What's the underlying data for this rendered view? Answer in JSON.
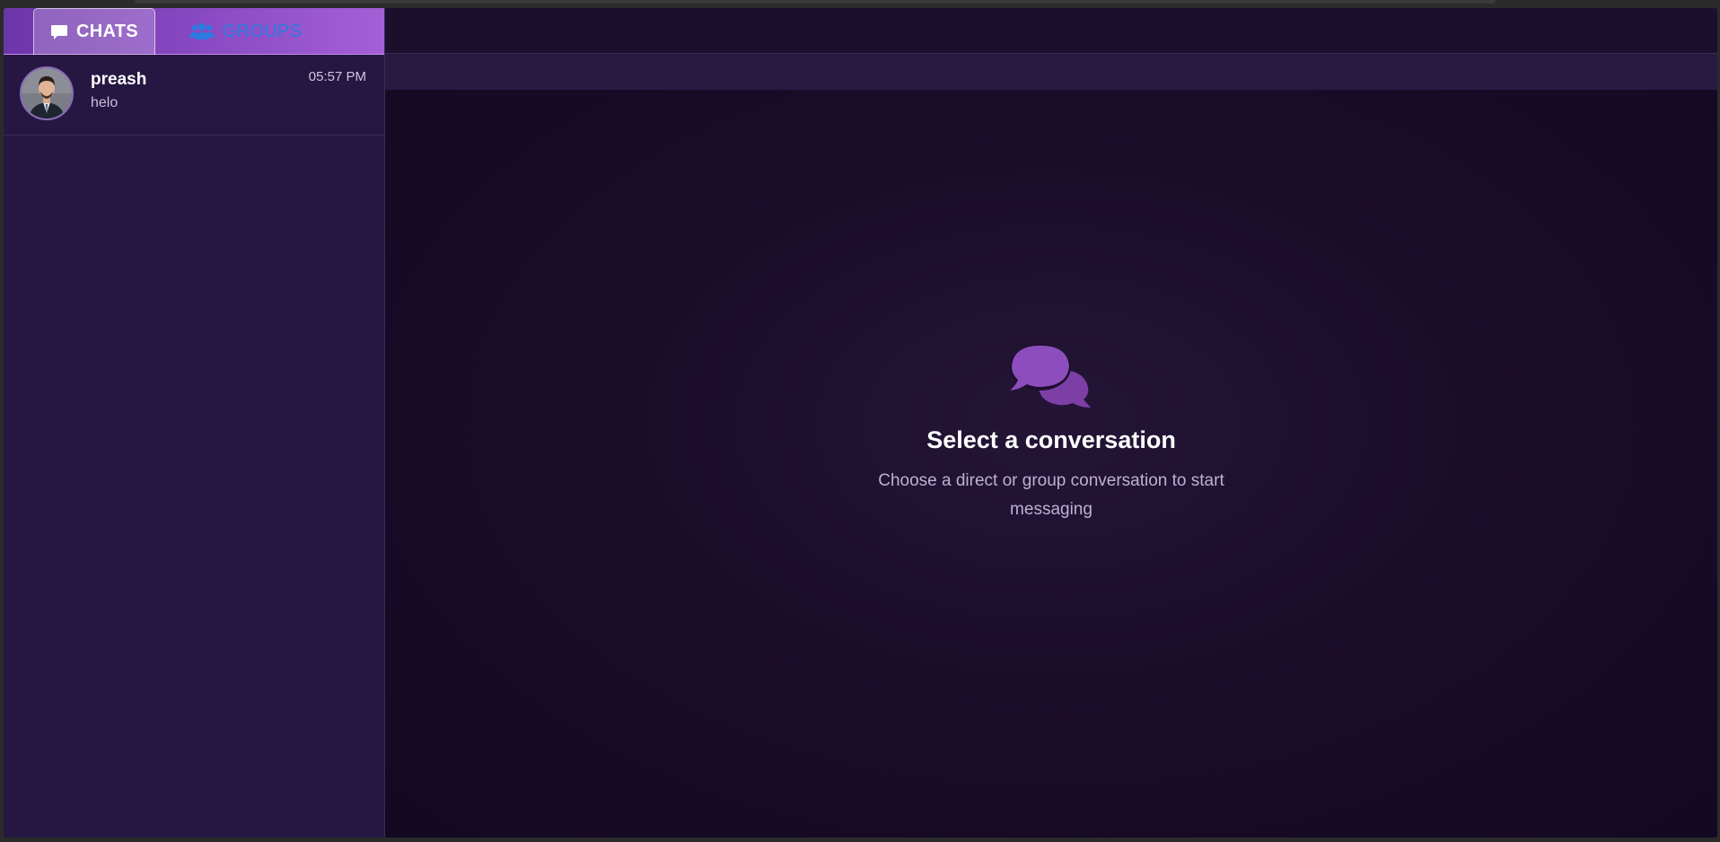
{
  "sidebar": {
    "tabs": [
      {
        "label": "CHATS",
        "icon": "comment-icon",
        "active": true
      },
      {
        "label": "GROUPS",
        "icon": "users-icon",
        "active": false
      }
    ],
    "chats": [
      {
        "name": "preash",
        "preview": "helo",
        "time": "05:57 PM"
      }
    ]
  },
  "main": {
    "empty_state": {
      "icon": "comments-icon",
      "title": "Select a conversation",
      "subtitle": "Choose a direct or group conversation to start messaging"
    }
  },
  "colors": {
    "accent": "#8a4bc4",
    "sidebar_bg": "#251742",
    "main_bg": "#150a24",
    "inactive_tab_text": "#2b7be0"
  }
}
